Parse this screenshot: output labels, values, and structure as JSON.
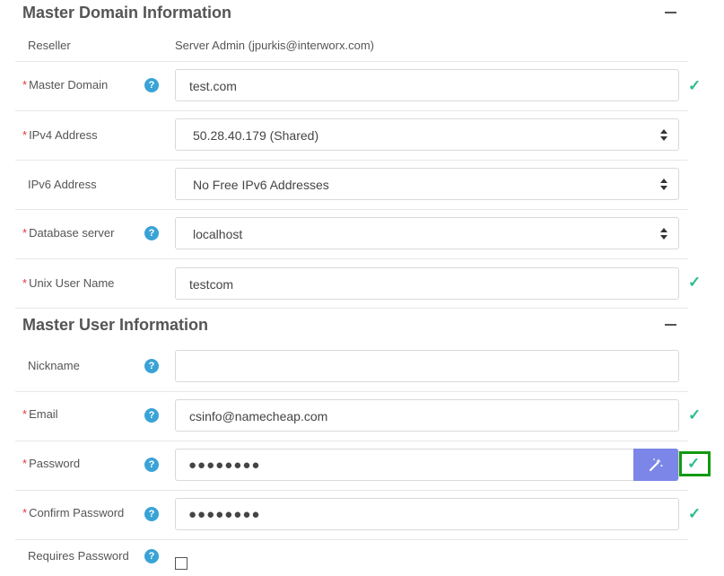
{
  "master_domain_section": {
    "title": "Master Domain Information"
  },
  "reseller": {
    "label": "Reseller",
    "value": "Server Admin (jpurkis@interworx.com)"
  },
  "master_domain": {
    "label": "Master Domain",
    "value": "test.com"
  },
  "ipv4": {
    "label": "IPv4 Address",
    "value": "50.28.40.179 (Shared)"
  },
  "ipv6": {
    "label": "IPv6 Address",
    "value": "No Free IPv6 Addresses"
  },
  "database_server": {
    "label": "Database server",
    "value": "localhost"
  },
  "unix_user": {
    "label": "Unix User Name",
    "value": "testcom"
  },
  "master_user_section": {
    "title": "Master User Information"
  },
  "nickname": {
    "label": "Nickname",
    "value": ""
  },
  "email": {
    "label": "Email",
    "value": "csinfo@namecheap.com"
  },
  "password": {
    "label": "Password",
    "value": "●●●●●●●●"
  },
  "confirm_password": {
    "label": "Confirm Password",
    "value": "●●●●●●●●"
  },
  "requires_password": {
    "label": "Requires Password"
  },
  "common": {
    "required_mark": "*",
    "help_glyph": "?",
    "check_glyph": "✓"
  },
  "colors": {
    "accent": "#3aa3d6",
    "valid": "#2bbf8a",
    "required": "#e03a3a",
    "generate_button": "#7b86e8",
    "highlight": "#119a11"
  },
  "icons": {
    "help": "question-circle-icon",
    "valid": "checkmark-icon",
    "generate": "magic-wand-icon",
    "collapse": "minus-icon"
  }
}
